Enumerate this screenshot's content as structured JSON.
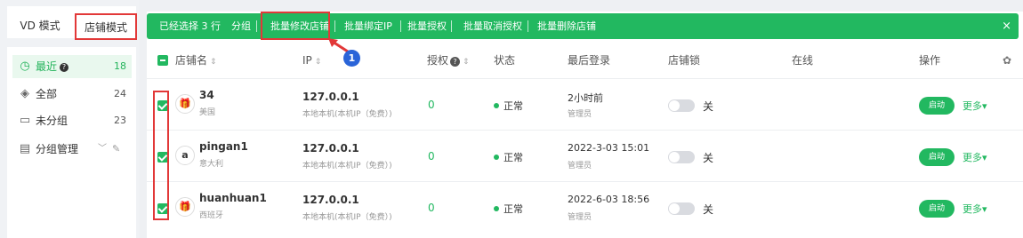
{
  "sidebar": {
    "mode_tabs": {
      "vd": "VD 模式",
      "store": "店铺模式"
    },
    "items": [
      {
        "label": "最近",
        "count": "18",
        "icon": "clock-icon",
        "help": "?"
      },
      {
        "label": "全部",
        "count": "24",
        "icon": "layers-icon"
      },
      {
        "label": "未分组",
        "count": "23",
        "icon": "inbox-icon"
      },
      {
        "label": "分组管理",
        "icon": "folder-icon"
      }
    ]
  },
  "bulkbar": {
    "selected": "已经选择 3 行",
    "group": "分组",
    "actions": [
      "批量修改店铺",
      "批量绑定IP",
      "批量授权",
      "批量取消授权",
      "批量删除店铺"
    ],
    "close": "×"
  },
  "annotation": {
    "number": "1"
  },
  "table": {
    "headers": {
      "name": "店铺名",
      "ip": "IP",
      "auth": "授权",
      "help": "?",
      "status": "状态",
      "last_login": "最后登录",
      "lock": "店铺锁",
      "online": "在线",
      "ops": "操作"
    },
    "rows": [
      {
        "name": "34",
        "region": "美国",
        "logo": "gift-box-icon",
        "ip": "127.0.0.1",
        "ip_note": "本地本机(本机IP（免费）)",
        "auth": "0",
        "status": "正常",
        "last_login": "2小时前",
        "login_role": "管理员",
        "lock": "关",
        "start": "启动",
        "more": "更多"
      },
      {
        "name": "pingan1",
        "region": "意大利",
        "logo": "a",
        "ip": "127.0.0.1",
        "ip_note": "本地本机(本机IP（免费）)",
        "auth": "0",
        "status": "正常",
        "last_login": "2022-3-03 15:01",
        "login_role": "管理员",
        "lock": "关",
        "start": "启动",
        "more": "更多"
      },
      {
        "name": "huanhuan1",
        "region": "西班牙",
        "logo": "gift-box-icon",
        "ip": "127.0.0.1",
        "ip_note": "本地本机(本机IP（免费）)",
        "auth": "0",
        "status": "正常",
        "last_login": "2022-6-03 18:56",
        "login_role": "管理员",
        "lock": "关",
        "start": "启动",
        "more": "更多"
      }
    ]
  },
  "colors": {
    "accent": "#22b860",
    "highlight": "#e23838",
    "callout": "#2a64d8"
  }
}
